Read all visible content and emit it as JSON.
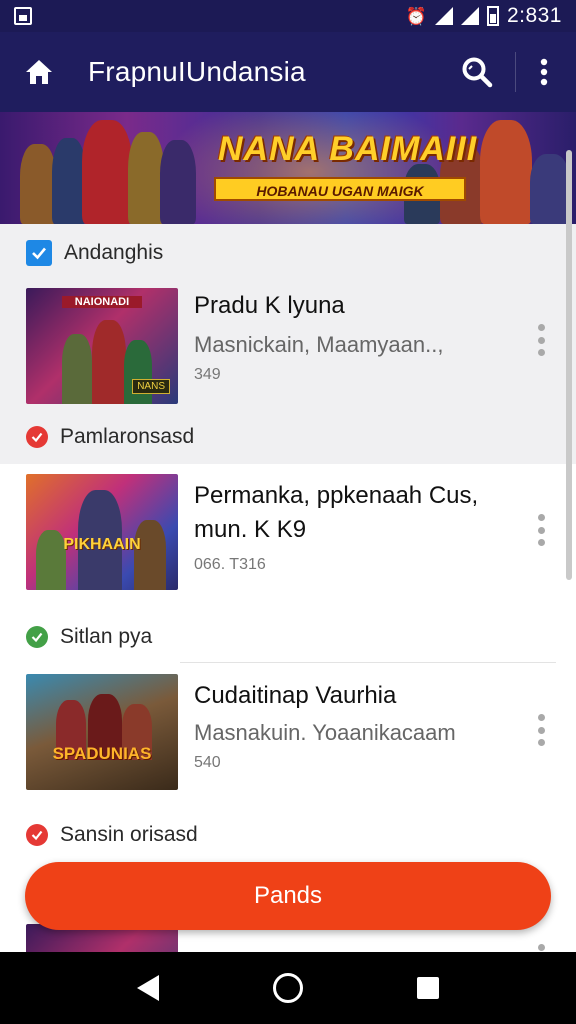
{
  "status_bar": {
    "time": "2:831"
  },
  "app_bar": {
    "title": "FrapnuIUndansia"
  },
  "banner": {
    "title": "NANA BAIMAIII",
    "subtitle": "HOBANAU UGAN MAIGK"
  },
  "sections": [
    {
      "label": "Andanghis"
    },
    {
      "label": "Pamlaronsasd"
    },
    {
      "label": "Sitlan pya"
    },
    {
      "label": "Sansin orisasd"
    }
  ],
  "items": [
    {
      "thumb_caption": "NAIONADI",
      "thumb_badge": "NANS",
      "title": "Pradu K lyuna",
      "subtitle": "Masnickain, Maamyaan..,",
      "meta": "349"
    },
    {
      "thumb_caption": "PIKHAAIN",
      "title_line1": "Permanka, ppkenaah Cus,",
      "title_line2": "mun. K K9",
      "meta": "066. T316"
    },
    {
      "thumb_caption": "SPADUNIAS",
      "title": "Cudaitinap Vaurhia",
      "subtitle": "Masnakuin. Yoaanikacaam",
      "meta": "540"
    }
  ],
  "cta": {
    "label": "Pands"
  },
  "colors": {
    "app_bar": "#1f1d5e",
    "cta": "#ef4117",
    "checkbox": "#1e88e5",
    "red_badge": "#e53935",
    "green_badge": "#43a047"
  }
}
